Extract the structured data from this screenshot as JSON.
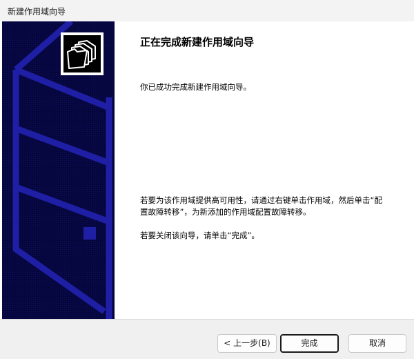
{
  "window": {
    "title": "新建作用域向导"
  },
  "content": {
    "heading": "正在完成新建作用域向导",
    "para1": "你已成功完成新建作用域向导。",
    "para2": "若要为该作用域提供高可用性，请通过右键单击作用域，然后单击“配置故障转移”，为新添加的作用域配置故障转移。",
    "para3": "若要关闭该向导，请单击“完成”。"
  },
  "buttons": {
    "back": "< 上一步(B)",
    "finish": "完成",
    "cancel": "取消"
  },
  "colors": {
    "sidebar_bg": "#06063f",
    "sidebar_lines": "#1f1fa6",
    "footer_bg": "#f0f0f0"
  },
  "icons": {
    "logo": "folders-icon"
  }
}
